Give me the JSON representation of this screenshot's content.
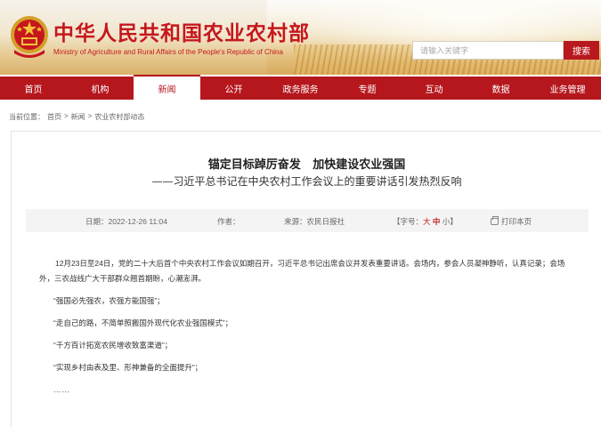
{
  "header": {
    "title": "中华人民共和国农业农村部",
    "subtitle": "Ministry of Agriculture and Rural Affairs of the People's Republic of China",
    "emblem_icon": "national-emblem-icon",
    "search_placeholder": "请输入关键字",
    "search_button": "搜索"
  },
  "nav": {
    "items": [
      "首页",
      "机构",
      "新闻",
      "公开",
      "政务服务",
      "专题",
      "互动",
      "数据",
      "业务管理"
    ],
    "active": "新闻"
  },
  "breadcrumb": {
    "prefix": "当前位置：",
    "items": [
      "首页",
      "新闻",
      "农业农村部动态"
    ],
    "separator": ">"
  },
  "article": {
    "title": "锚定目标踔厉奋发   加快建设农业强国",
    "subtitle": "——习近平总书记在中央农村工作会议上的重要讲话引发热烈反响",
    "meta": {
      "date": "日期：2022-12-26 11:04",
      "author": "作者：",
      "source": "来源：农民日报社",
      "fontsize_label": "【字号：",
      "fontsize_big": "大",
      "fontsize_mid": "中",
      "fontsize_small": "小",
      "fontsize_end": "】",
      "print": "打印本页"
    },
    "paragraphs": [
      "12月23日至24日，党的二十大后首个中央农村工作会议如期召开，习近平总书记出席会议并发表重要讲话。会场内，参会人员凝神静听，认真记录；会场外，三农战线广大干部群众翘首期盼，心潮澎湃。",
      "“强国必先强农，农强方能国强”；",
      "“走自己的路，不简单照搬国外现代化农业强国模式”；",
      "“千方百计拓宽农民增收致富渠道”；",
      "“实现乡村由表及里、形神兼备的全面提升”；",
      "……"
    ]
  },
  "colors": {
    "brand_red": "#c6171d",
    "nav_red": "#b5171d"
  }
}
